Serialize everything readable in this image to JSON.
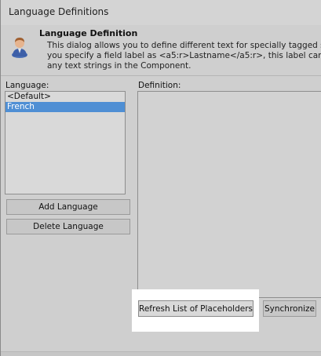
{
  "window": {
    "title": "Language Definitions"
  },
  "header": {
    "title": "Language Definition",
    "description": "This dialog allows you to define different text for specially tagged strings\nyou specify a field label as <a5:r>Lastname</a5:r>, this label can be rep\nany text strings in the Component."
  },
  "language_panel": {
    "label": "Language:",
    "items": [
      {
        "label": "<Default>",
        "selected": false
      },
      {
        "label": "French",
        "selected": true
      }
    ],
    "add_label": "Add Language",
    "delete_label": "Delete Language"
  },
  "definition_panel": {
    "label": "Definition:"
  },
  "buttons": {
    "refresh_label": "Refresh List of Placeholders",
    "synchronize_label": "Synchronize"
  },
  "colors": {
    "selection": "#4f8fd4",
    "dialog_bg": "#cfcfcf",
    "highlight": "#ffffff"
  },
  "icons": {
    "header_icon": "user-icon"
  }
}
